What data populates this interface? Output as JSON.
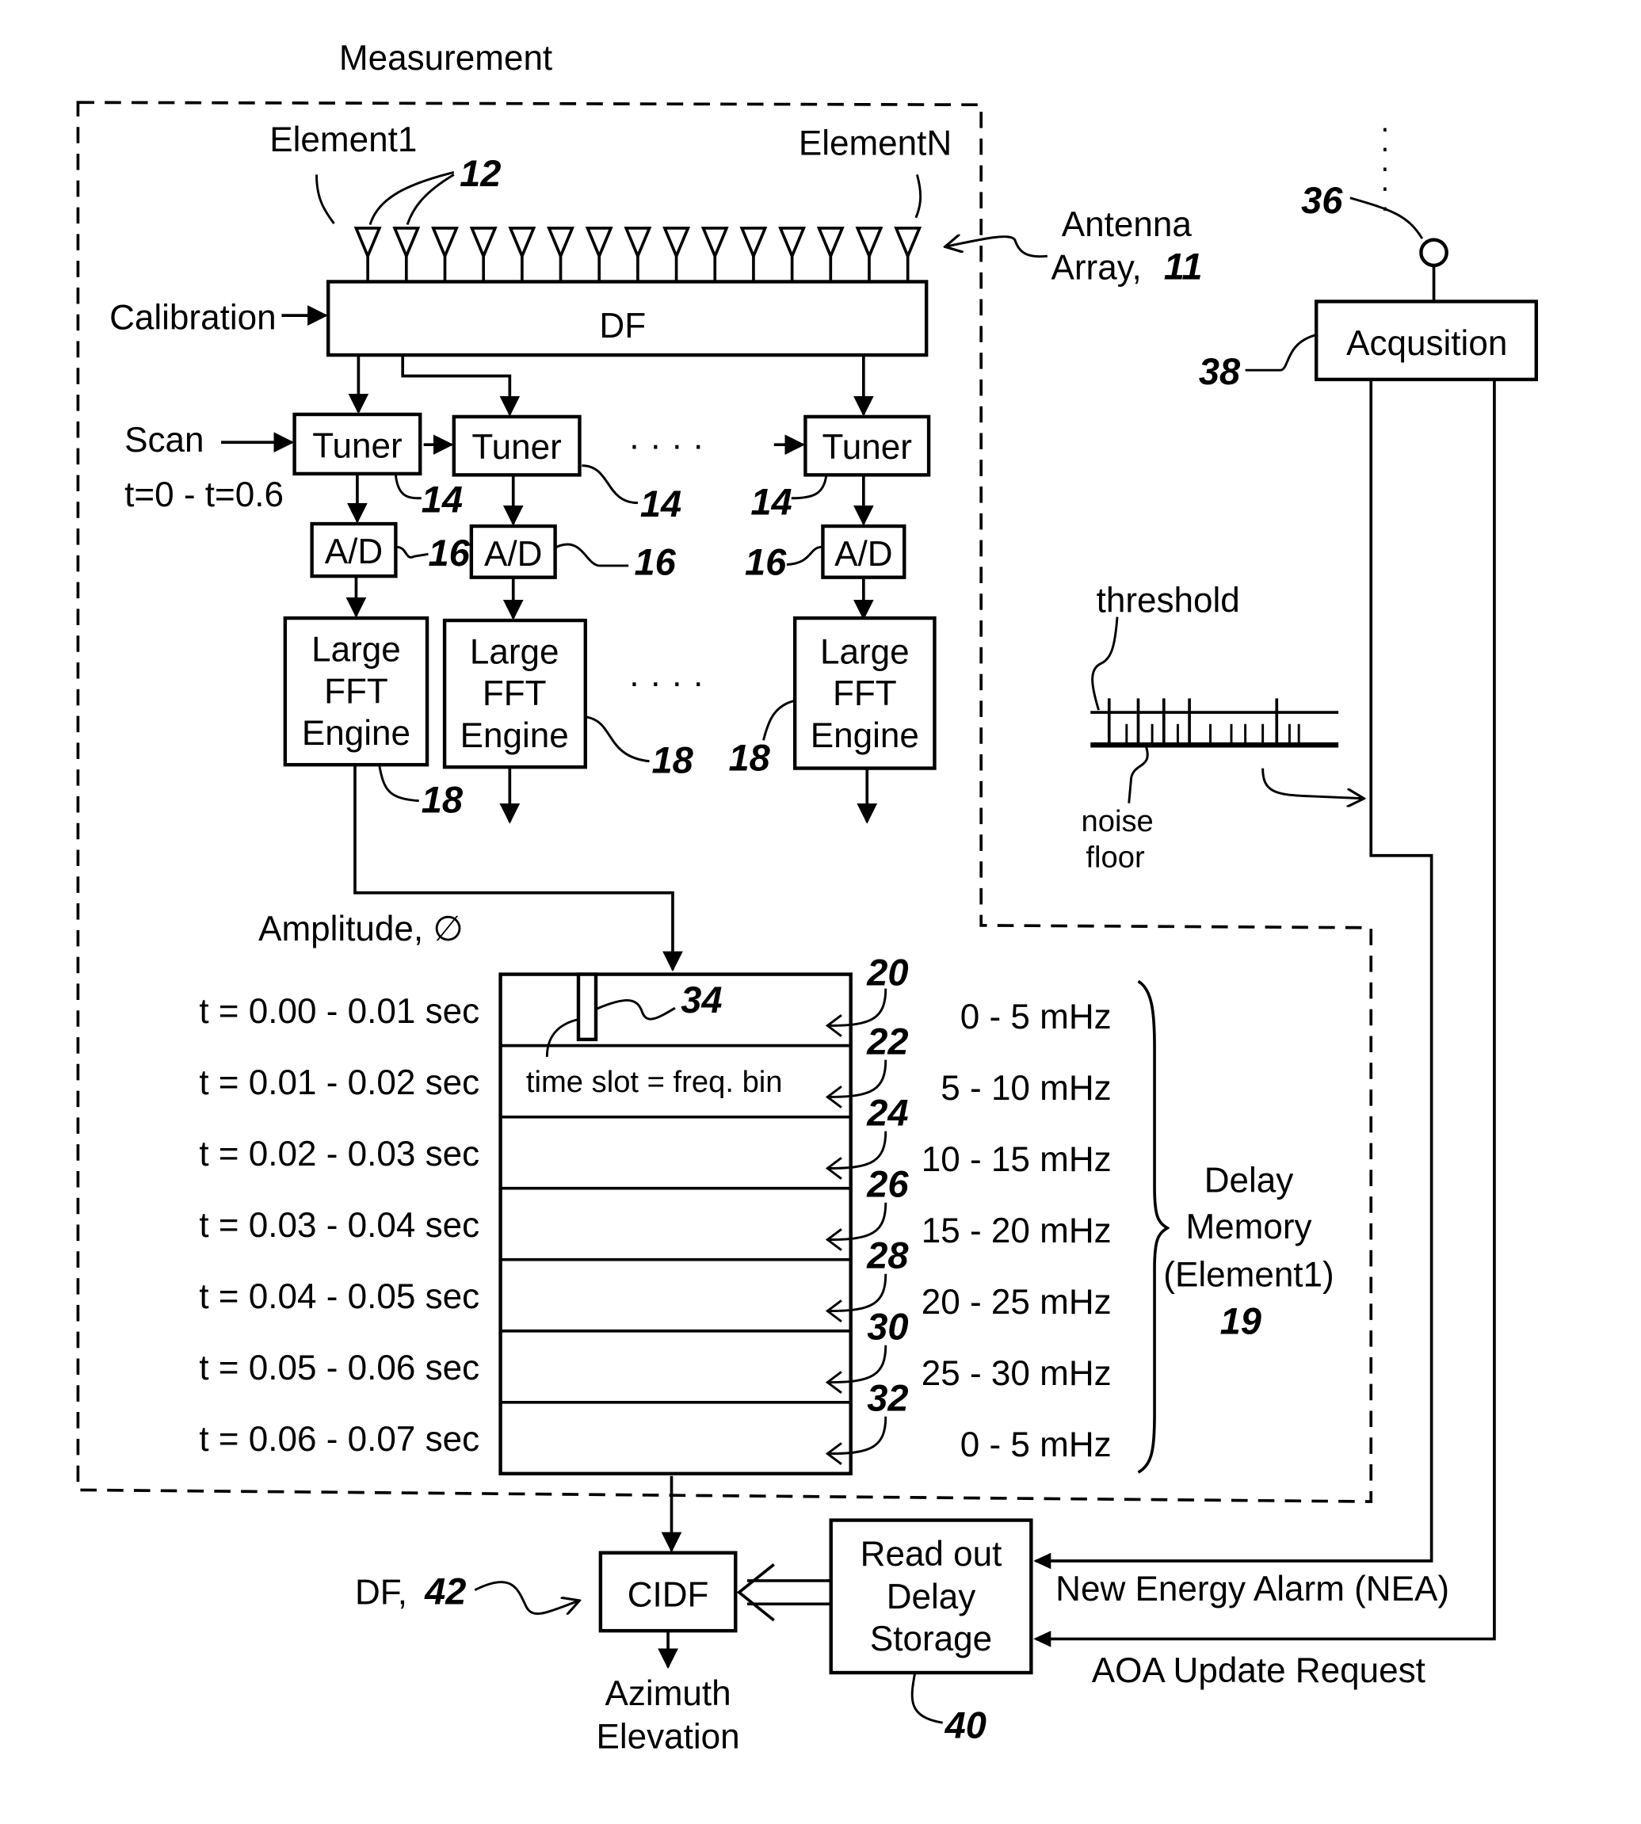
{
  "diagram": {
    "title": "Measurement",
    "antenna": {
      "element_first": "Element1",
      "element_last": "ElementN",
      "element_ref": "12",
      "element_count_drawn": 15,
      "array_label_line1": "Antenna",
      "array_label_line2": "Array,",
      "array_ref": "11"
    },
    "df_block": {
      "label": "DF",
      "input_label": "Calibration"
    },
    "scan": {
      "label": "Scan",
      "range": "t=0 - t=0.6"
    },
    "tuners": [
      {
        "label": "Tuner",
        "ref": "14"
      },
      {
        "label": "Tuner",
        "ref": "14"
      },
      {
        "label": "Tuner",
        "ref": "14"
      }
    ],
    "ad_converters": [
      {
        "label": "A/D",
        "ref": "16"
      },
      {
        "label": "A/D",
        "ref": "16"
      },
      {
        "label": "A/D",
        "ref": "16"
      }
    ],
    "fft_engines": [
      {
        "line1": "Large",
        "line2": "FFT",
        "line3": "Engine",
        "ref": "18"
      },
      {
        "line1": "Large",
        "line2": "FFT",
        "line3": "Engine",
        "ref": "18"
      },
      {
        "line1": "Large",
        "line2": "FFT",
        "line3": "Engine",
        "ref": "18"
      }
    ],
    "ellipsis": "· · · ·",
    "amplitude_label": "Amplitude, ∅",
    "delay_memory": {
      "slot_marker_ref": "34",
      "slot_note": "time slot = freq. bin",
      "rows": [
        {
          "time": "t = 0.00 - 0.01 sec",
          "freq": "0 - 5 mHz",
          "ref": "20"
        },
        {
          "time": "t = 0.01 - 0.02 sec",
          "freq": "5 - 10 mHz",
          "ref": "22"
        },
        {
          "time": "t = 0.02 - 0.03 sec",
          "freq": "10 - 15 mHz",
          "ref": "24"
        },
        {
          "time": "t = 0.03 - 0.04 sec",
          "freq": "15 - 20 mHz",
          "ref": "26"
        },
        {
          "time": "t = 0.04 - 0.05 sec",
          "freq": "20 - 25 mHz",
          "ref": "28"
        },
        {
          "time": "t = 0.05 - 0.06 sec",
          "freq": "25 - 30 mHz",
          "ref": "30"
        },
        {
          "time": "t = 0.06 - 0.07 sec",
          "freq": "0 - 5 mHz",
          "ref": "32"
        }
      ],
      "label_line1": "Delay",
      "label_line2": "Memory",
      "label_line3": "(Element1)",
      "ref": "19"
    },
    "acquisition": {
      "label": "Acqusition",
      "ref": "38",
      "antenna_ref": "36"
    },
    "threshold_plot": {
      "threshold_label": "threshold",
      "noise_label_line1": "noise",
      "noise_label_line2": "floor"
    },
    "readout": {
      "line1": "Read out",
      "line2": "Delay",
      "line3": "Storage",
      "ref": "40"
    },
    "cidf": {
      "label": "CIDF",
      "df_label": "DF,",
      "df_ref": "42",
      "output_line1": "Azimuth",
      "output_line2": "Elevation"
    },
    "signals": {
      "nea": "New Energy Alarm (NEA)",
      "aoa": "AOA Update Request"
    }
  }
}
